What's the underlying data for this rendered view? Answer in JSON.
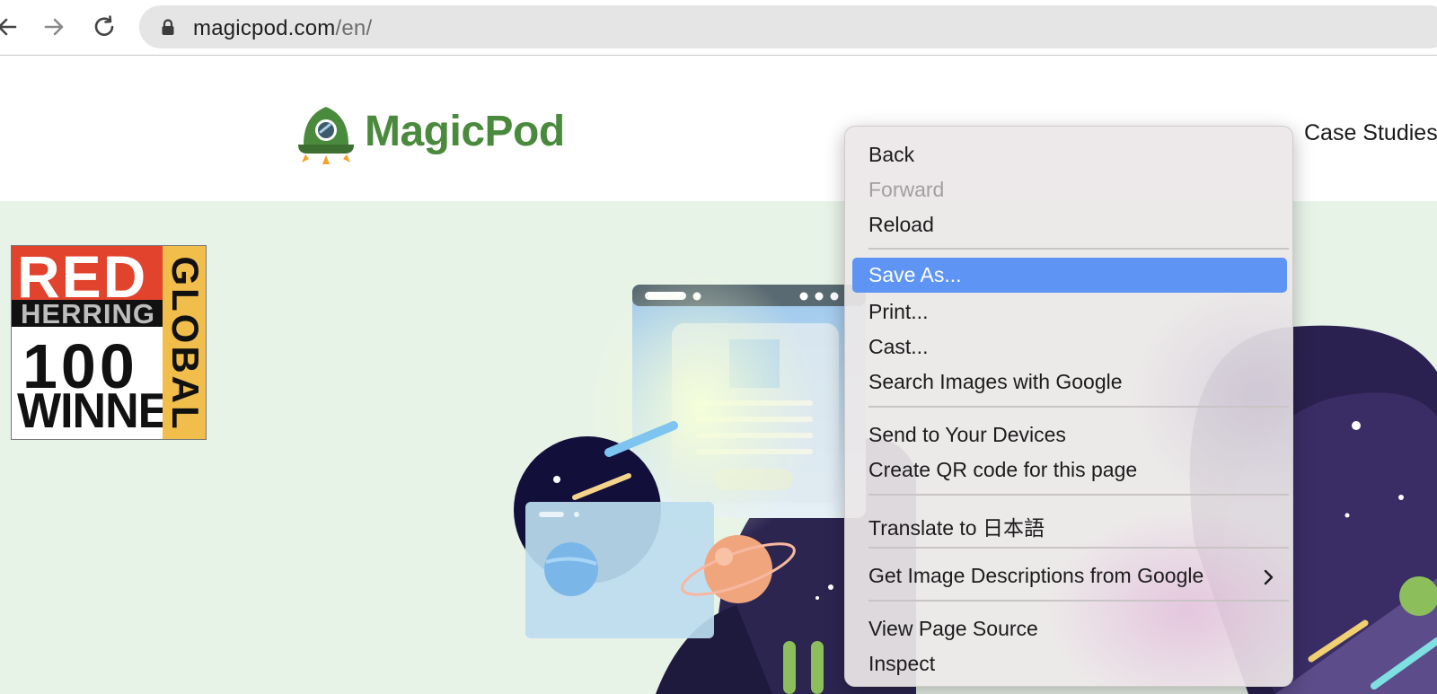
{
  "browser": {
    "url_host": "magicpod.com",
    "url_path": "/en/"
  },
  "site": {
    "logo_text": "MagicPod",
    "nav": [
      "Case Studies"
    ],
    "brand_color": "#4a8a3c"
  },
  "badge": {
    "line1": "RED",
    "line2": "HERRING",
    "line3": "100",
    "line4": "WINNER",
    "side": "GLOBAL"
  },
  "context_menu": {
    "groups": [
      [
        {
          "label": "Back",
          "state": "enabled"
        },
        {
          "label": "Forward",
          "state": "disabled"
        },
        {
          "label": "Reload",
          "state": "enabled"
        }
      ],
      [
        {
          "label": "Save As...",
          "state": "highlighted"
        },
        {
          "label": "Print...",
          "state": "enabled"
        },
        {
          "label": "Cast...",
          "state": "enabled"
        },
        {
          "label": "Search Images with Google",
          "state": "enabled"
        }
      ],
      [
        {
          "label": "Send to Your Devices",
          "state": "enabled"
        },
        {
          "label": "Create QR code for this page",
          "state": "enabled"
        }
      ],
      [
        {
          "label": "Translate to 日本語",
          "state": "enabled"
        }
      ],
      [
        {
          "label": "Get Image Descriptions from Google",
          "state": "enabled",
          "submenu": true
        }
      ],
      [
        {
          "label": "View Page Source",
          "state": "enabled"
        },
        {
          "label": "Inspect",
          "state": "enabled"
        }
      ]
    ],
    "highlight_color": "#5e95f4"
  }
}
